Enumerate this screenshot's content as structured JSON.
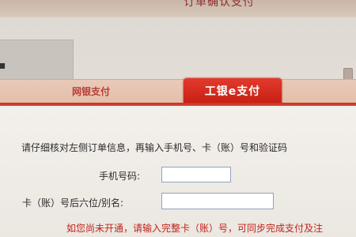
{
  "header": {
    "title": "订单确认支付"
  },
  "tabs": {
    "online_banking": "网银支付",
    "icbc_e_pay": "工银e支付"
  },
  "form": {
    "instruction": "请仔细核对左侧订单信息，再输入手机号、卡（账）号和验证码",
    "phone_label": "手机号码:",
    "phone_value": "",
    "card_label": "卡（账）号后六位/别名:",
    "card_value": "",
    "notice": "如您尚未开通，请输入完整卡（账）号，可同步完成支付及注"
  },
  "colors": {
    "accent_red": "#d32a1e",
    "tab_text_red": "#b33a32",
    "notice_red": "#c2221b"
  }
}
